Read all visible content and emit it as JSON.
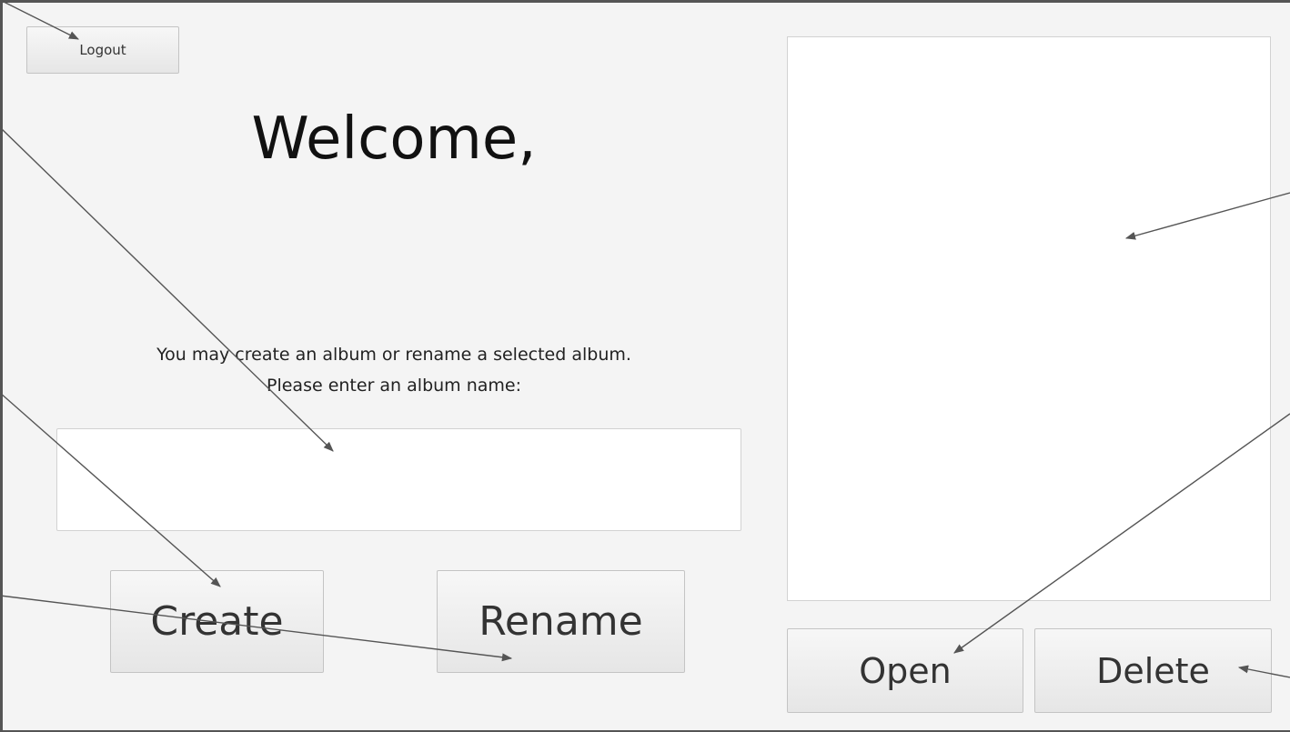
{
  "header": {
    "logout_label": "Logout",
    "welcome_text": "Welcome,"
  },
  "form": {
    "instruction_line1": "You may create an album or rename a selected album.",
    "instruction_line2": "Please enter an album name:",
    "album_name_value": "",
    "album_name_placeholder": "",
    "create_label": "Create",
    "rename_label": "Rename"
  },
  "albums": {
    "items": [],
    "open_label": "Open",
    "delete_label": "Delete"
  },
  "colors": {
    "background": "#f4f4f4",
    "panel": "#ffffff",
    "arrow": "#555555"
  }
}
